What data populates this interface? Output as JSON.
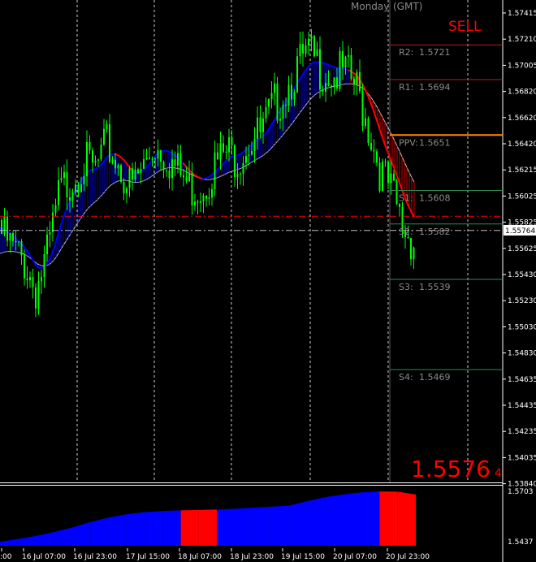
{
  "header": {
    "day_label": "Monday",
    "tz_label": "(GMT)",
    "signal_label": "SELL"
  },
  "price": {
    "big_main": "1.5576",
    "big_sub": "4",
    "current_tag": "1.55764"
  },
  "colors": {
    "background": "#000000",
    "candle": "#00ff00",
    "ma_fast_up": "#0000ff",
    "ma_fast_down": "#ff0000",
    "ma_slow": "#c0c0c0",
    "pivot": "#ff8c00",
    "resistance": "#b22222",
    "support": "#2e8b57",
    "histogram_up": "#0000ff",
    "histogram_down": "#ff0000",
    "signal_text": "#ff0000",
    "axis_text": "#ffffff"
  },
  "chart_data": {
    "type": "candlestick",
    "title": "",
    "ylim": [
      1.5384,
      1.5752
    ],
    "y_ticks": [
      "1.57415",
      "1.57210",
      "1.57005",
      "1.56820",
      "1.56620",
      "1.56420",
      "1.56215",
      "1.56025",
      "1.55825",
      "1.55625",
      "1.55430",
      "1.55230",
      "1.55030",
      "1.54830",
      "1.54635",
      "1.54435",
      "1.54235",
      "1.54035",
      "1.53840"
    ],
    "x_ticks": [
      ":00",
      "16 Jul 07:00",
      "16 Jul 23:00",
      "17 Jul 15:00",
      "18 Jul 07:00",
      "18 Jul 23:00",
      "19 Jul 15:00",
      "20 Jul 07:00",
      "20 Jul 23:00"
    ],
    "pivot_levels": [
      {
        "label": "R2:",
        "value": 1.5721,
        "value_text": "1.5721",
        "kind": "resistance"
      },
      {
        "label": "R1:",
        "value": 1.5694,
        "value_text": "1.5694",
        "kind": "resistance"
      },
      {
        "label": "PPV:",
        "value": 1.5651,
        "value_text": "1.5651",
        "kind": "pivot"
      },
      {
        "label": "S1:",
        "value": 1.5608,
        "value_text": "1.5608",
        "kind": "support"
      },
      {
        "label": "S2:",
        "value": 1.5582,
        "value_text": "1.5582",
        "kind": "support"
      },
      {
        "label": "S3:",
        "value": 1.5539,
        "value_text": "1.5539",
        "kind": "support"
      },
      {
        "label": "S4:",
        "value": 1.5469,
        "value_text": "1.5469",
        "kind": "support"
      }
    ],
    "horizontal_lines": [
      {
        "value": 1.5588,
        "style": "dash-dot",
        "color": "#ff0000"
      },
      {
        "value": 1.5577,
        "style": "dash-dot",
        "color": "#c0c0c0"
      }
    ],
    "close_path": [
      1.5585,
      1.5572,
      1.5562,
      1.554,
      1.5567,
      1.5615,
      1.5626,
      1.5639,
      1.5632,
      1.5652,
      1.5637,
      1.5618,
      1.5634,
      1.5653,
      1.5645,
      1.5631,
      1.5619,
      1.562,
      1.5635,
      1.5646,
      1.5643,
      1.5657,
      1.566,
      1.5682,
      1.5695,
      1.5712,
      1.5722,
      1.5712,
      1.5706,
      1.5708,
      1.5697,
      1.5667,
      1.5633,
      1.5614,
      1.5586,
      1.5576
    ],
    "indicator": {
      "ylim": [
        1.5437,
        1.5703
      ],
      "y_ticks": [
        "1.5703",
        "1.5437"
      ],
      "values": [
        1.5455,
        1.5468,
        1.5482,
        1.55,
        1.552,
        1.5545,
        1.5565,
        1.558,
        1.559,
        1.5595,
        1.5598,
        1.56,
        1.5602,
        1.5605,
        1.561,
        1.5615,
        1.562,
        1.564,
        1.5658,
        1.567,
        1.568,
        1.5684,
        1.5683,
        1.567
      ],
      "signal": [
        "up",
        "up",
        "up",
        "up",
        "up",
        "up",
        "up",
        "up",
        "up",
        "up",
        "down",
        "down",
        "up",
        "up",
        "up",
        "up",
        "up",
        "up",
        "up",
        "up",
        "up",
        "down",
        "down",
        "down"
      ]
    }
  }
}
